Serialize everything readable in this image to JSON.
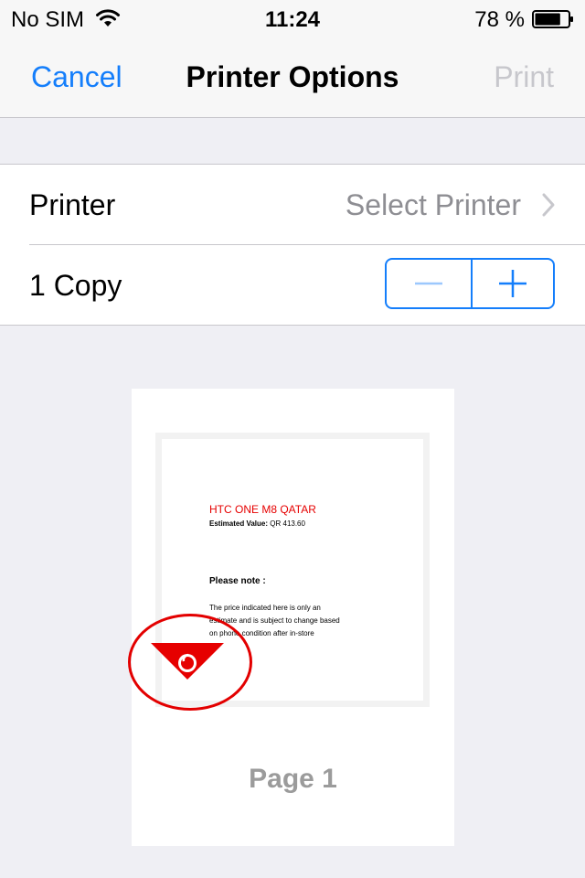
{
  "status_bar": {
    "carrier": "No SIM",
    "time": "11:24",
    "battery_percent": "78 %",
    "battery_level": 0.78
  },
  "nav": {
    "cancel_label": "Cancel",
    "title": "Printer Options",
    "print_label": "Print"
  },
  "printer_row": {
    "label": "Printer",
    "value": "Select Printer"
  },
  "copies_row": {
    "label": "1 Copy"
  },
  "preview": {
    "doc_title": "HTC ONE M8 QATAR",
    "estimated_label": "Estimated Value:",
    "estimated_value": "QR 413.60",
    "note_heading": "Please note :",
    "body_lines": [
      "The price indicated here is only an",
      "estimate and is subject to change based",
      "on phone condition after in-store"
    ],
    "page_label": "Page 1"
  },
  "colors": {
    "accent": "#147efb",
    "disabled": "#c7c7cc",
    "brand_red": "#e60000"
  },
  "icons": [
    "wifi-icon",
    "battery-icon",
    "chevron-right-icon",
    "minus-icon",
    "plus-icon",
    "vodafone-logo"
  ]
}
